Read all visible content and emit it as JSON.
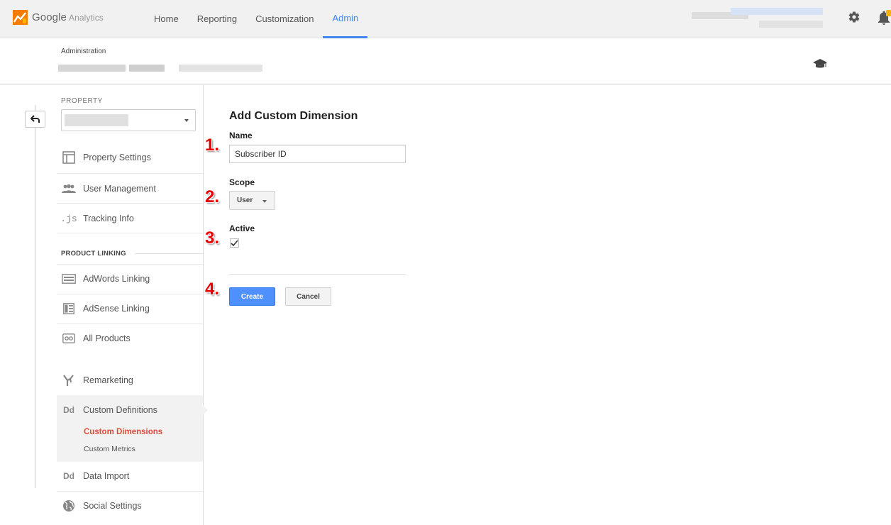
{
  "app": {
    "brand_google": "Google",
    "brand_product": "Analytics"
  },
  "nav": {
    "items": [
      {
        "label": "Home"
      },
      {
        "label": "Reporting"
      },
      {
        "label": "Customization"
      },
      {
        "label": "Admin",
        "active": true
      }
    ]
  },
  "header": {
    "administration_label": "Administration"
  },
  "sidebar": {
    "property_label": "PROPERTY",
    "property_items": [
      {
        "label": "Property Settings",
        "icon": "property-settings-icon"
      },
      {
        "label": "User Management",
        "icon": "user-management-icon"
      },
      {
        "label": "Tracking Info",
        "icon": "tracking-info-icon"
      }
    ],
    "product_linking_label": "PRODUCT LINKING",
    "linking_items": [
      {
        "label": "AdWords Linking",
        "icon": "adwords-icon"
      },
      {
        "label": "AdSense Linking",
        "icon": "adsense-icon"
      },
      {
        "label": "All Products",
        "icon": "all-products-icon"
      }
    ],
    "remarketing": {
      "label": "Remarketing"
    },
    "custom_definitions": {
      "label": "Custom Definitions",
      "icon_text": "Dd",
      "sub_items": [
        {
          "label": "Custom Dimensions",
          "active": true
        },
        {
          "label": "Custom Metrics"
        }
      ]
    },
    "data_import": {
      "label": "Data Import",
      "icon_text": "Dd"
    },
    "social_settings": {
      "label": "Social Settings"
    }
  },
  "form": {
    "title": "Add Custom Dimension",
    "name_label": "Name",
    "name_value": "Subscriber ID",
    "scope_label": "Scope",
    "scope_value": "User",
    "active_label": "Active",
    "active_checked": true,
    "create_label": "Create",
    "cancel_label": "Cancel"
  },
  "annotations": {
    "step1": "1.",
    "step2": "2.",
    "step3": "3.",
    "step4": "4."
  },
  "colors": {
    "accent_blue": "#4285f4",
    "active_red": "#dd4b39",
    "step_red": "#e60000",
    "logo_orange": "#f57c00",
    "logo_yellow": "#ffb300"
  }
}
